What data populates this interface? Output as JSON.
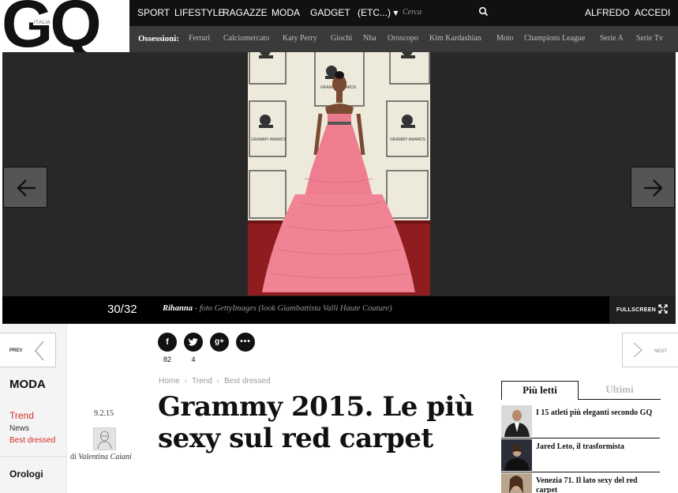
{
  "brand": {
    "logo_text": "GQ",
    "edition": "ITALIA"
  },
  "topnav": {
    "items": [
      "SPORT",
      "LIFESTYLE",
      "RAGAZZE",
      "MODA",
      "GADGET",
      "(ETC...) ▾"
    ],
    "search_placeholder": "Cerca",
    "user_links": [
      "ALFREDO",
      "ACCEDI"
    ]
  },
  "subnav": {
    "label": "Ossessioni:",
    "items": [
      "Ferrari",
      "Calciomercato",
      "Katy Perry",
      "Giochi",
      "Nba",
      "Oroscopo",
      "Kim Kardashian",
      "Moto",
      "Champions League",
      "Serie A",
      "Serie Tv"
    ]
  },
  "gallery": {
    "counter": "30/32",
    "caption_name": "Rihanna",
    "caption_credit": " - foto GettyImages (look Giambattista Valli Haute Couture)",
    "fullscreen_label": "FULLSCREEN",
    "backdrop_text": "GRAMMY AWARDS"
  },
  "pager": {
    "prev_label": "PREV",
    "next_label": "NEXT"
  },
  "sidebar": {
    "section": "MODA",
    "links": [
      {
        "label": "Trend",
        "color": "#d62b2b"
      },
      {
        "label": "News",
        "color": "#333333"
      },
      {
        "label": "Best dressed",
        "color": "#d62b2b"
      }
    ],
    "next_section": "Orologi"
  },
  "share": [
    {
      "icon": "f",
      "count": "82"
    },
    {
      "icon": "twitter",
      "count": "4"
    },
    {
      "icon": "g+",
      "count": ""
    },
    {
      "icon": "more",
      "count": ""
    }
  ],
  "article": {
    "date": "9.2.15",
    "byline_prefix": "di ",
    "author": "Valentina Caiani",
    "breadcrumb": [
      "Home",
      "Trend",
      "Best dressed"
    ],
    "headline": "Grammy 2015. Le più sexy sul red carpet"
  },
  "popular": {
    "tabs": [
      "Più letti",
      "Ultimi"
    ],
    "items": [
      "I 15 atleti più eleganti secondo GQ",
      "Jared Leto, il trasformista",
      "Venezia 71. Il lato sexy del red carpet"
    ]
  },
  "colors": {
    "accent_red": "#d62b2b",
    "header_bg": "#111111",
    "subnav_bg": "#3a3a3a"
  }
}
